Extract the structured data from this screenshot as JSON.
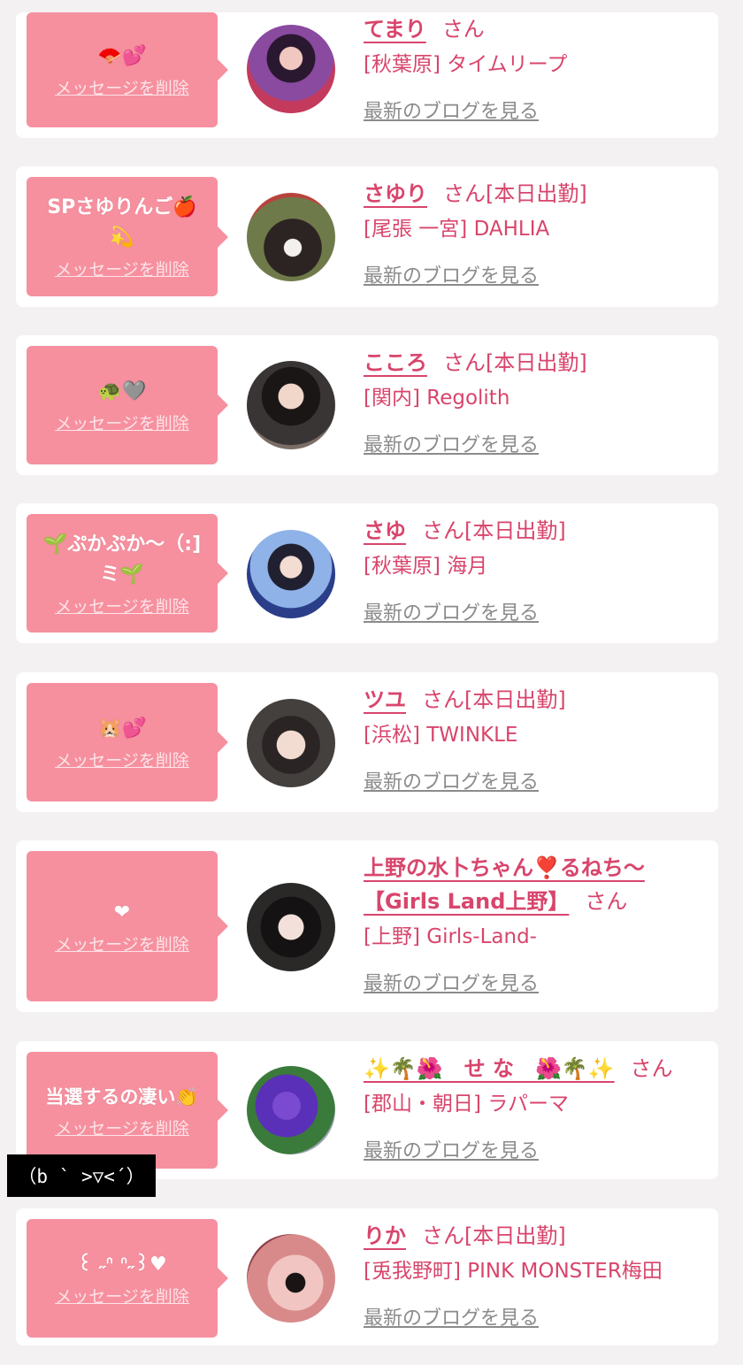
{
  "cards": [
    {
      "message": "🪭💕",
      "delete_label": "メッセージを削除",
      "name": "てまり",
      "san": "さん",
      "shop": "[秋葉原] タイムリープ",
      "blog": "最新のブログを見る"
    },
    {
      "message": "SPさゆりんご🍎💫",
      "delete_label": "メッセージを削除",
      "name": "さゆり",
      "san": "さん[本日出勤]",
      "shop": "[尾張 一宮] DAHLIA",
      "blog": "最新のブログを見る"
    },
    {
      "message": "🐢🩶",
      "delete_label": "メッセージを削除",
      "name": "こころ",
      "san": "さん[本日出勤]",
      "shop": "[関内] Regolith",
      "blog": "最新のブログを見る"
    },
    {
      "message": "🌱ぷかぷか〜（:]ミ🌱",
      "delete_label": "メッセージを削除",
      "name": "さゆ",
      "san": "さん[本日出勤]",
      "shop": "[秋葉原] 海月",
      "blog": "最新のブログを見る"
    },
    {
      "message": "🐹💕",
      "delete_label": "メッセージを削除",
      "name": "ツユ",
      "san": "さん[本日出勤]",
      "shop": "[浜松] TWINKLE",
      "blog": "最新のブログを見る"
    },
    {
      "message": "❤",
      "delete_label": "メッセージを削除",
      "name": "上野の水卜ちゃん❣️るねち〜【Girls Land上野】",
      "san": "さん",
      "shop": "[上野] Girls-Land-",
      "blog": "最新のブログを見る"
    },
    {
      "message": "当選するの凄い👏",
      "delete_label": "メッセージを削除",
      "name": "✨🌴🌺　せ な　🌺🌴✨",
      "san": "さん",
      "shop": "[郡山・朝日] ラパーマ",
      "blog": "最新のブログを見る"
    },
    {
      "message": "꒰ ˶ᐢ ᐢ˶꒱♥",
      "delete_label": "メッセージを削除",
      "name": "りか",
      "san": "さん[本日出勤]",
      "shop": "[兎我野町] PINK MONSTER梅田",
      "blog": "最新のブログを見る"
    }
  ],
  "overlay_text": "（b ` >▽<´）",
  "colors": {
    "bubble": "#f6909f",
    "accent": "#d8456c",
    "link_gray": "#8b8b8b",
    "page_bg": "#f3f1f2"
  }
}
